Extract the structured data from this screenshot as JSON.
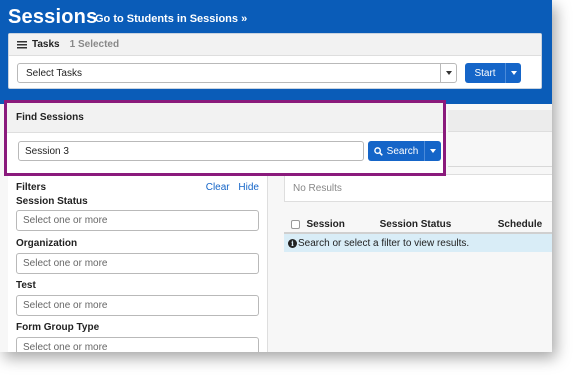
{
  "header": {
    "title": "Sessions",
    "goto_link": "Go to Students in Sessions »"
  },
  "tasks": {
    "title": "Tasks",
    "selected_count": "1 Selected",
    "select_value": "Select Tasks",
    "start_label": "Start"
  },
  "find_sessions": {
    "title": "Find Sessions",
    "search_value": "Session 3",
    "search_button_label": "Search"
  },
  "filters": {
    "title": "Filters",
    "clear_label": "Clear",
    "hide_label": "Hide",
    "items": [
      {
        "label": "Session Status",
        "placeholder": "Select one or more"
      },
      {
        "label": "Organization",
        "placeholder": "Select one or more"
      },
      {
        "label": "Test",
        "placeholder": "Select one or more"
      },
      {
        "label": "Form Group Type",
        "placeholder": "Select one or more"
      }
    ]
  },
  "results": {
    "no_results_text": "No Results",
    "columns": [
      "Session",
      "Session Status",
      "Schedule"
    ],
    "info_message": "Search or select a filter to view results."
  },
  "colors": {
    "brand_blue": "#0a5cb8",
    "button_blue": "#1565c8",
    "highlight_purple": "#8a1a7c",
    "info_bg": "#d9edf7"
  }
}
